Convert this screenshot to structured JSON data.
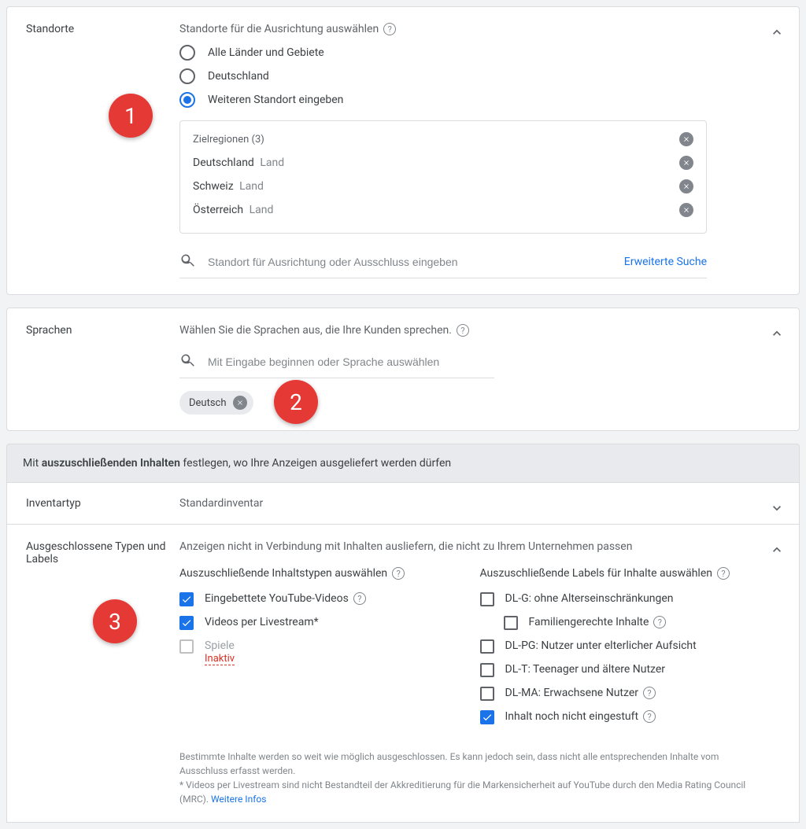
{
  "locations": {
    "title": "Standorte",
    "subtitle": "Standorte für die Ausrichtung auswählen",
    "options": {
      "all": "Alle Länder und Gebiete",
      "de": "Deutschland",
      "custom": "Weiteren Standort eingeben"
    },
    "targets_title": "Zielregionen (3)",
    "targets": [
      {
        "name": "Deutschland",
        "type": "Land"
      },
      {
        "name": "Schweiz",
        "type": "Land"
      },
      {
        "name": "Österreich",
        "type": "Land"
      }
    ],
    "search_placeholder": "Standort für Ausrichtung oder Ausschluss eingeben",
    "advanced": "Erweiterte Suche"
  },
  "languages": {
    "title": "Sprachen",
    "subtitle": "Wählen Sie die Sprachen aus, die Ihre Kunden sprechen.",
    "search_placeholder": "Mit Eingabe beginnen oder Sprache auswählen",
    "chip": "Deutsch"
  },
  "exclusions": {
    "header_pre": "Mit ",
    "header_bold": "auszuschließenden Inhalten",
    "header_post": " festlegen, wo Ihre Anzeigen ausgeliefert werden dürfen",
    "inventory_label": "Inventartyp",
    "inventory_value": "Standardinventar",
    "excluded_label": "Ausgeschlossene Typen und Labels",
    "desc": "Anzeigen nicht in Verbindung mit Inhalten ausliefern, die nicht zu Ihrem Unternehmen passen",
    "types_title": "Auszuschließende Inhaltstypen auswählen",
    "labels_title": "Auszuschließende Labels für Inhalte auswählen",
    "types": {
      "embedded": "Eingebettete YouTube-Videos",
      "livestream": "Videos per Livestream",
      "games": "Spiele",
      "inactive": "Inaktiv"
    },
    "labels": {
      "dlg": "DL-G: ohne Alterseinschränkungen",
      "family": "Familiengerechte Inhalte",
      "dlpg": "DL-PG: Nutzer unter elterlicher Aufsicht",
      "dlt": "DL-T: Teenager und ältere Nutzer",
      "dlma": "DL-MA: Erwachsene Nutzer",
      "notrated": "Inhalt noch nicht eingestuft"
    },
    "footnote1": "Bestimmte Inhalte werden so weit wie möglich ausgeschlossen. Es kann jedoch sein, dass nicht alle entsprechenden Inhalte vom Ausschluss erfasst werden.",
    "footnote2": "* Videos per Livestream sind nicht Bestandteil der Akkreditierung für die Markensicherheit auf YouTube durch den Media Rating Council (MRC). ",
    "more": "Weitere Infos"
  },
  "callouts": {
    "one": "1",
    "two": "2",
    "three": "3"
  }
}
